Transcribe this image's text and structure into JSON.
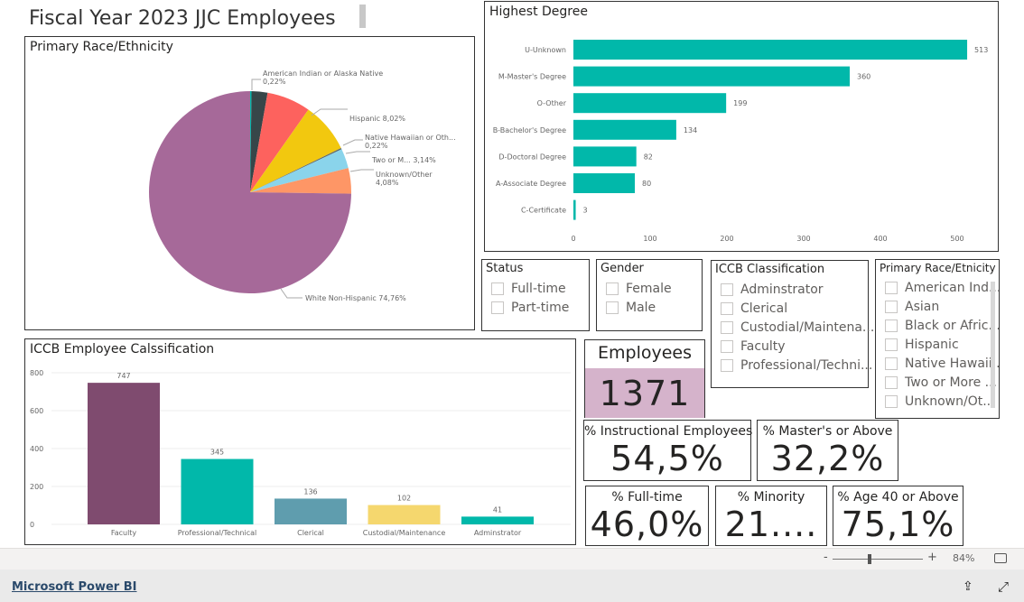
{
  "report_title": "Fiscal Year 2023 JJC Employees",
  "pie": {
    "title": "Primary Race/Ethnicity",
    "chart_data": {
      "type": "pie",
      "slices": [
        {
          "name": "American Indian or Alaska Native",
          "value": 0.22,
          "label": "American Indian or Alaska Native",
          "pct": "0,22%",
          "color": "#01B8AA"
        },
        {
          "name": "Asian",
          "value": 2.55,
          "color": "#374649"
        },
        {
          "name": "Black or African American",
          "value": 7.0,
          "color": "#FD625E"
        },
        {
          "name": "Hispanic",
          "value": 8.02,
          "label": "Hispanic 8,02%",
          "color": "#F2C80F"
        },
        {
          "name": "Native Hawaiian or Other Pacific Islander",
          "value": 0.22,
          "label": "Native Hawaiian or Oth...",
          "pct": "0,22%",
          "color": "#5F6B6D"
        },
        {
          "name": "Two or More",
          "value": 3.14,
          "label": "Two or M... 3,14%",
          "color": "#8AD4EB"
        },
        {
          "name": "Unknown/Other",
          "value": 4.08,
          "label": "Unknown/Other",
          "pct": "4,08%",
          "color": "#FE9666"
        },
        {
          "name": "White Non-Hispanic",
          "value": 74.76,
          "label": "White Non-Hispanic 74,76%",
          "color": "#A66999"
        }
      ]
    }
  },
  "degree": {
    "title": "Highest Degree",
    "chart_data": {
      "type": "bar",
      "orientation": "horizontal",
      "categories": [
        "U-Unknown",
        "M-Master's Degree",
        "O-Other",
        "B-Bachelor's Degree",
        "D-Doctoral Degree",
        "A-Associate Degree",
        "C-Certificate"
      ],
      "values": [
        513,
        360,
        199,
        134,
        82,
        80,
        3
      ],
      "xticks": [
        "0",
        "100",
        "200",
        "300",
        "400",
        "500"
      ],
      "xlim": [
        0,
        500
      ],
      "color": "#01B8AA"
    }
  },
  "iccb_chart": {
    "title": "ICCB Employee Calssification",
    "chart_data": {
      "type": "bar",
      "categories": [
        "Faculty",
        "Professional/Technical",
        "Clerical",
        "Custodial/Maintenance",
        "Adminstrator"
      ],
      "values": [
        747,
        345,
        136,
        102,
        41
      ],
      "colors": [
        "#7F4B6F",
        "#01B8AA",
        "#5F9DAE",
        "#F5D76E",
        "#01B8AA"
      ],
      "yticks": [
        "0",
        "200",
        "400",
        "600",
        "800"
      ],
      "ylim": [
        0,
        800
      ]
    }
  },
  "slicers": {
    "status": {
      "title": "Status",
      "items": [
        "Full-time",
        "Part-time"
      ]
    },
    "gender": {
      "title": "Gender",
      "items": [
        "Female",
        "Male"
      ]
    },
    "iccb": {
      "title": "ICCB Classification",
      "items": [
        "Adminstrator",
        "Clerical",
        "Custodial/Maintena...",
        "Faculty",
        "Professional/Techni..."
      ]
    },
    "race": {
      "title": "Primary Race/Etnicity",
      "items": [
        "American Ind...",
        "Asian",
        "Black or Afric...",
        "Hispanic",
        "Native Hawaii...",
        "Two or More ...",
        "Unknown/Ot..."
      ]
    }
  },
  "cards": {
    "employees": {
      "title": "Employees",
      "value": "1371",
      "fill": "#D5B3CB"
    },
    "instructional": {
      "title": "% Instructional Employees",
      "value": "54,5%"
    },
    "masters": {
      "title": "% Master's or Above",
      "value": "32,2%"
    },
    "fulltime": {
      "title": "% Full-time",
      "value": "46,0%"
    },
    "minority": {
      "title": "% Minority",
      "value": "21...."
    },
    "age40": {
      "title": "% Age 40 or Above",
      "value": "75,1%"
    }
  },
  "footer": {
    "zoom": "84%",
    "zoom_level": 84,
    "brand": "Microsoft Power BI",
    "minus": "-",
    "plus": "+"
  }
}
